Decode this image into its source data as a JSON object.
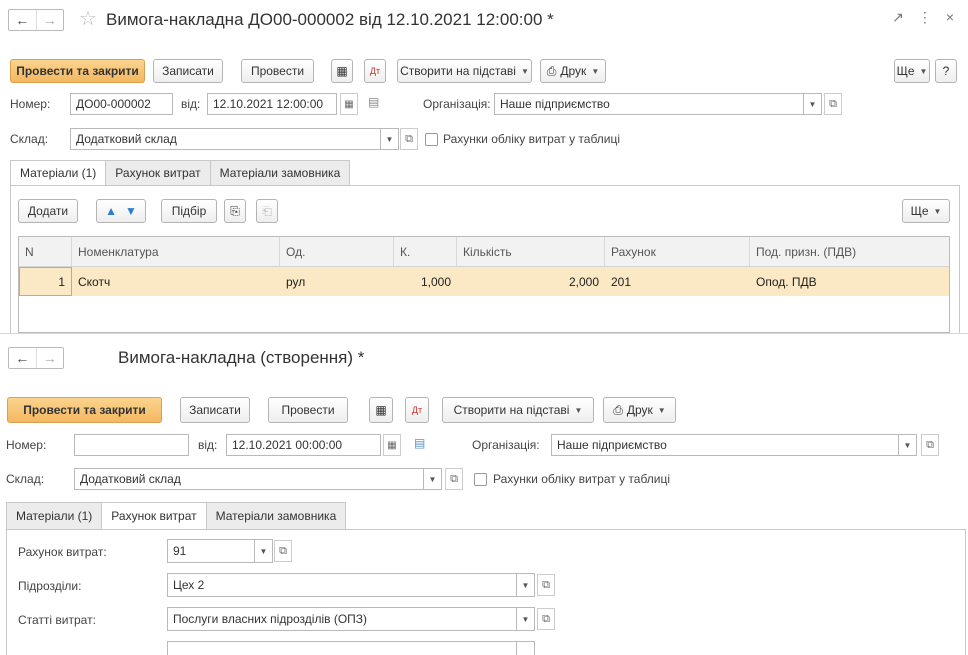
{
  "window1": {
    "title": "Вимога-накладна ДО00-000002 від 12.10.2021 12:00:00 *",
    "toolbar": {
      "post_close": "Провести та закрити",
      "save": "Записати",
      "post": "Провести",
      "create_based": "Створити на підставі",
      "print": "Друк",
      "more": "Ще",
      "help": "?"
    },
    "form": {
      "number_label": "Номер:",
      "number_value": "ДО00-000002",
      "date_label": "від:",
      "date_value": "12.10.2021 12:00:00",
      "org_label": "Організація:",
      "org_value": "Наше підприємство",
      "warehouse_label": "Склад:",
      "warehouse_value": "Додатковий склад",
      "checkbox_label": "Рахунки обліку витрат у таблиці"
    },
    "tabs": [
      "Матеріали (1)",
      "Рахунок витрат",
      "Матеріали замовника"
    ],
    "table_toolbar": {
      "add": "Додати",
      "select": "Підбір",
      "more": "Ще"
    },
    "table": {
      "headers": [
        "N",
        "Номенклатура",
        "Од.",
        "К.",
        "Кількість",
        "Рахунок",
        "Под. призн. (ПДВ)"
      ],
      "rows": [
        [
          "1",
          "Скотч",
          "рул",
          "1,000",
          "2,000",
          "201",
          "Опод. ПДВ"
        ]
      ]
    }
  },
  "window2": {
    "title": "Вимога-накладна (створення) *",
    "toolbar": {
      "post_close": "Провести та закрити",
      "save": "Записати",
      "post": "Провести",
      "create_based": "Створити на підставі",
      "print": "Друк"
    },
    "form": {
      "number_label": "Номер:",
      "number_value": "",
      "date_label": "від:",
      "date_value": "12.10.2021 00:00:00",
      "org_label": "Організація:",
      "org_value": "Наше підприємство",
      "warehouse_label": "Склад:",
      "warehouse_value": "Додатковий склад",
      "checkbox_label": "Рахунки обліку витрат у таблиці"
    },
    "tabs": [
      "Матеріали (1)",
      "Рахунок витрат",
      "Матеріали замовника"
    ],
    "expense": {
      "account_label": "Рахунок витрат:",
      "account_value": "91",
      "division_label": "Підрозділи:",
      "division_value": "Цех 2",
      "items_label": "Статті витрат:",
      "items_value": "Послуги власних підрозділів (ОПЗ)"
    }
  }
}
